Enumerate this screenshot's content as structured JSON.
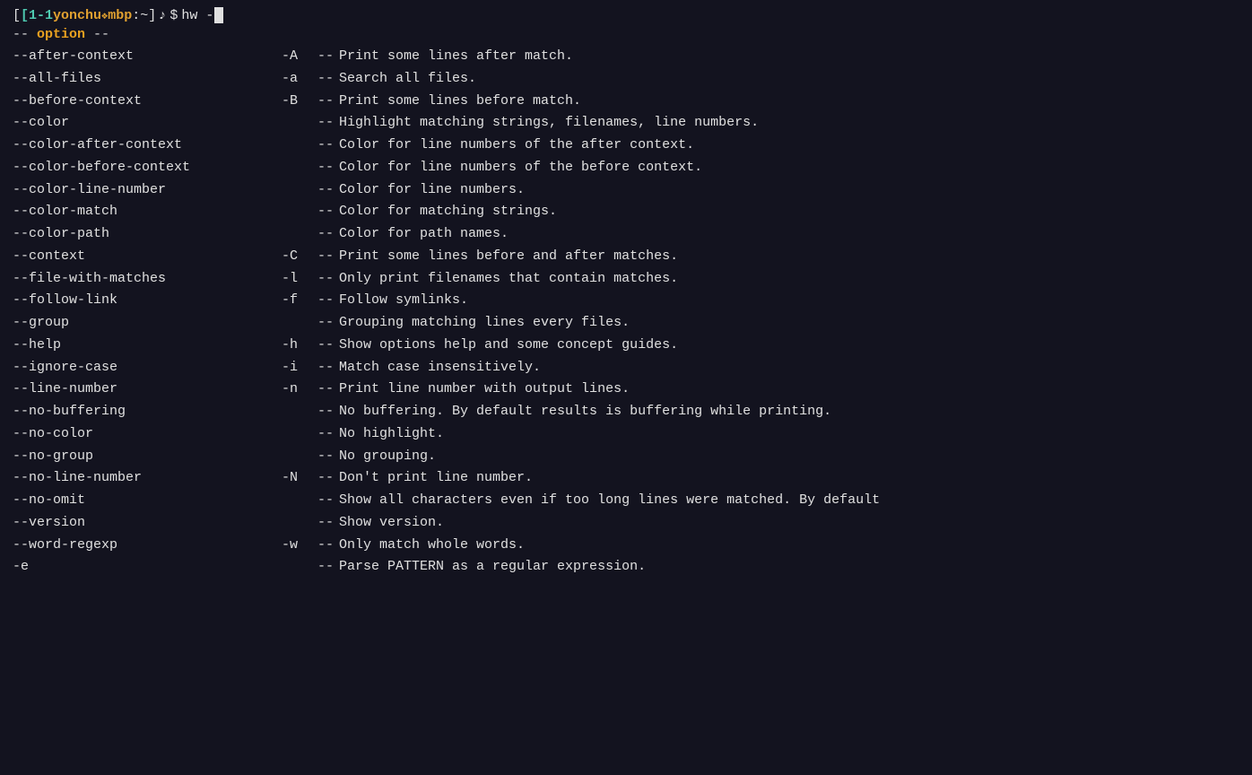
{
  "terminal": {
    "prompt": {
      "session": "[1-1",
      "user": "yonchu",
      "diamond1": "❖",
      "host": "mbp",
      "path": ":~]",
      "music": "♪",
      "dollar": "$",
      "command": "hw -"
    },
    "section_header": {
      "prefix": "--",
      "label": "option",
      "suffix": "--"
    },
    "options": [
      {
        "long": "--after-context",
        "short": "-A",
        "desc": "Print some lines after match."
      },
      {
        "long": "--all-files",
        "short": "-a",
        "desc": "Search all files."
      },
      {
        "long": "--before-context",
        "short": "-B",
        "desc": "Print some lines before match."
      },
      {
        "long": "--color",
        "short": "",
        "desc": "Highlight matching strings, filenames, line numbers."
      },
      {
        "long": "--color-after-context",
        "short": "",
        "desc": "Color for line numbers of the after context."
      },
      {
        "long": "--color-before-context",
        "short": "",
        "desc": "Color for line numbers of the before context."
      },
      {
        "long": "--color-line-number",
        "short": "",
        "desc": "Color for line numbers."
      },
      {
        "long": "--color-match",
        "short": "",
        "desc": "Color for matching strings."
      },
      {
        "long": "--color-path",
        "short": "",
        "desc": "Color for path names."
      },
      {
        "long": "--context",
        "short": "-C",
        "desc": "Print some lines before and after matches."
      },
      {
        "long": "--file-with-matches",
        "short": "-l",
        "desc": "Only print filenames that contain matches."
      },
      {
        "long": "--follow-link",
        "short": "-f",
        "desc": "Follow symlinks."
      },
      {
        "long": "--group",
        "short": "",
        "desc": "Grouping matching lines every files."
      },
      {
        "long": "--help",
        "short": "-h",
        "desc": "Show options help and some concept guides."
      },
      {
        "long": "--ignore-case",
        "short": "-i",
        "desc": "Match case insensitively."
      },
      {
        "long": "--line-number",
        "short": "-n",
        "desc": "Print line number with output lines."
      },
      {
        "long": "--no-buffering",
        "short": "",
        "desc": "No buffering. By default results is buffering while printing."
      },
      {
        "long": "--no-color",
        "short": "",
        "desc": "No highlight."
      },
      {
        "long": "--no-group",
        "short": "",
        "desc": "No grouping."
      },
      {
        "long": "--no-line-number",
        "short": "-N",
        "desc": "Don't print line number."
      },
      {
        "long": "--no-omit",
        "short": "",
        "desc": "Show all characters even if too long lines were matched. By default"
      },
      {
        "long": "--version",
        "short": "",
        "desc": "Show version."
      },
      {
        "long": "--word-regexp",
        "short": "-w",
        "desc": "Only match whole words."
      },
      {
        "long": "-e",
        "short": "",
        "desc": "Parse PATTERN as a regular expression."
      }
    ]
  }
}
